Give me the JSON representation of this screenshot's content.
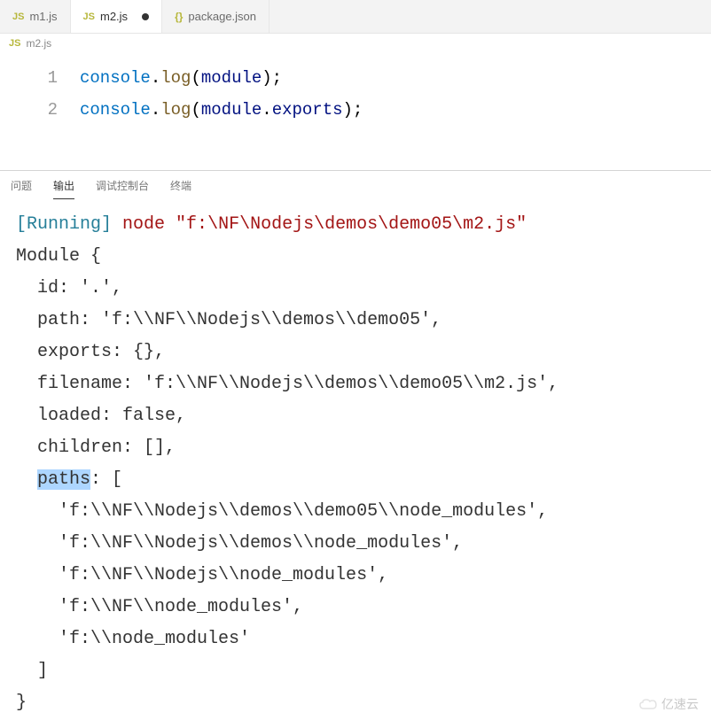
{
  "tabs": [
    {
      "icon": "JS",
      "label": "m1.js",
      "active": false,
      "dirty": false
    },
    {
      "icon": "JS",
      "label": "m2.js",
      "active": true,
      "dirty": true
    },
    {
      "icon": "{}",
      "label": "package.json",
      "active": false,
      "dirty": false
    }
  ],
  "breadcrumb": {
    "icon": "JS",
    "label": "m2.js"
  },
  "editor": {
    "lines": [
      {
        "num": "1",
        "tokens": [
          {
            "t": "console",
            "c": "tok-ident"
          },
          {
            "t": ".",
            "c": "tok-punct"
          },
          {
            "t": "log",
            "c": "tok-method"
          },
          {
            "t": "(",
            "c": "tok-punct"
          },
          {
            "t": "module",
            "c": "tok-var"
          },
          {
            "t": ");",
            "c": "tok-punct"
          }
        ]
      },
      {
        "num": "2",
        "tokens": [
          {
            "t": "console",
            "c": "tok-ident"
          },
          {
            "t": ".",
            "c": "tok-punct"
          },
          {
            "t": "log",
            "c": "tok-method"
          },
          {
            "t": "(",
            "c": "tok-punct"
          },
          {
            "t": "module",
            "c": "tok-var"
          },
          {
            "t": ".",
            "c": "tok-punct"
          },
          {
            "t": "exports",
            "c": "tok-var"
          },
          {
            "t": ");",
            "c": "tok-punct"
          }
        ]
      }
    ]
  },
  "panel": {
    "tabs": {
      "problems": "问题",
      "output": "输出",
      "debug": "调试控制台",
      "terminal": "终端"
    },
    "active": "output"
  },
  "output": {
    "running_label": "[Running]",
    "command": "node \"f:\\NF\\Nodejs\\demos\\demo05\\m2.js\"",
    "module_word": "Module",
    "fields": {
      "id": "id: '.',",
      "path": "path: 'f:\\\\NF\\\\Nodejs\\\\demos\\\\demo05',",
      "exports": "exports: {},",
      "filename": "filename: 'f:\\\\NF\\\\Nodejs\\\\demos\\\\demo05\\\\m2.js',",
      "loaded": "loaded: false,",
      "children": "children: [],",
      "paths_key": "paths",
      "paths_rest": ": [",
      "paths_items": [
        "'f:\\\\NF\\\\Nodejs\\\\demos\\\\demo05\\\\node_modules',",
        "'f:\\\\NF\\\\Nodejs\\\\demos\\\\node_modules',",
        "'f:\\\\NF\\\\Nodejs\\\\node_modules',",
        "'f:\\\\NF\\\\node_modules',",
        "'f:\\\\node_modules'"
      ],
      "paths_close": "]",
      "close": "}"
    }
  },
  "watermark": "亿速云"
}
